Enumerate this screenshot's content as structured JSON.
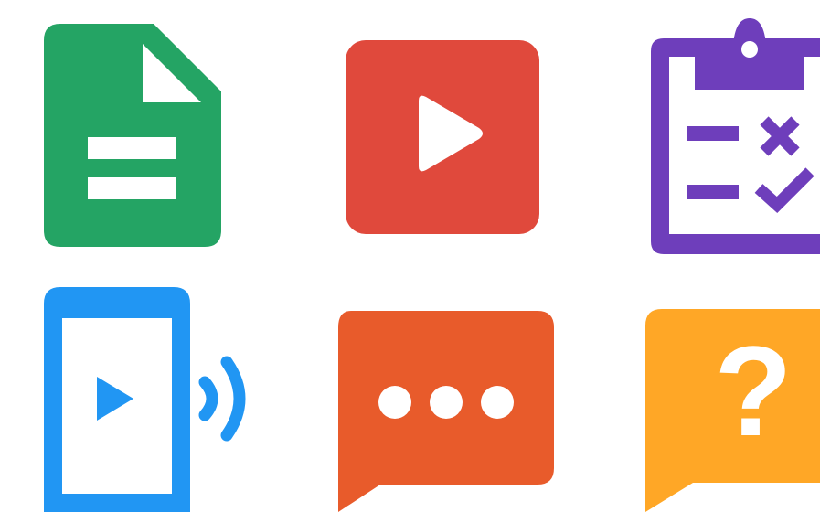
{
  "icons": [
    {
      "id": "icon-document",
      "name": "document-icon",
      "color": "#24A464"
    },
    {
      "id": "icon-video",
      "name": "video-play-icon",
      "color": "#E0493C"
    },
    {
      "id": "icon-clipboard",
      "name": "quiz-clipboard-icon",
      "color": "#6E3EBB"
    },
    {
      "id": "icon-cast",
      "name": "mobile-cast-video-icon",
      "color": "#2196F3"
    },
    {
      "id": "icon-chat",
      "name": "chat-bubble-icon",
      "color": "#E85B2B"
    },
    {
      "id": "icon-question",
      "name": "question-bubble-icon",
      "color": "#FFA726"
    }
  ],
  "question_mark": "?"
}
